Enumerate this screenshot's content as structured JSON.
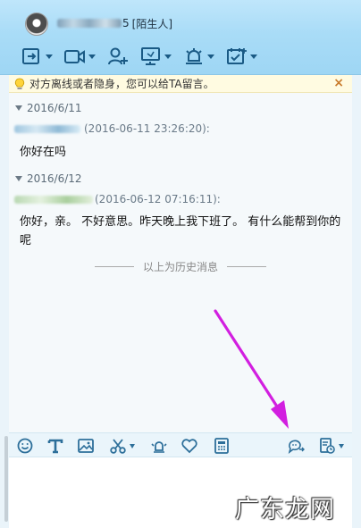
{
  "window": {
    "contact_name_suffix": "5",
    "contact_tag": "[陌生人]"
  },
  "toolbar": {
    "items": [
      {
        "icon": "share-screen-icon"
      },
      {
        "icon": "video-call-icon"
      },
      {
        "icon": "add-friend-icon"
      },
      {
        "icon": "remote-desktop-icon"
      },
      {
        "icon": "alert-icon"
      },
      {
        "icon": "schedule-icon"
      }
    ]
  },
  "notice": {
    "text": "对方离线或者隐身，您可以给TA留言。",
    "close": "×"
  },
  "chat": {
    "groups": [
      {
        "date": "2016/6/11",
        "timestamp": "(2016-06-11 23:26:20):",
        "message": "你好在吗"
      },
      {
        "date": "2016/6/12",
        "timestamp": "(2016-06-12 07:16:11):",
        "message": "你好，亲。 不好意思。昨天晚上我下班了。 有什么能帮到你的呢"
      }
    ],
    "history_label": "以上为历史消息"
  },
  "input_toolbar": {
    "items": [
      "emoji-icon",
      "font-icon",
      "image-icon",
      "scissors-icon",
      "shake-icon",
      "heart-icon",
      "calculator-icon",
      "voice-message-icon",
      "history-icon"
    ]
  },
  "watermark": "广东龙网",
  "colors": {
    "title_bg": "#a9dcf7",
    "chat_bg": "#f5f9fb",
    "notice_bg": "#fffbe1",
    "arrow": "#d21fe0"
  }
}
